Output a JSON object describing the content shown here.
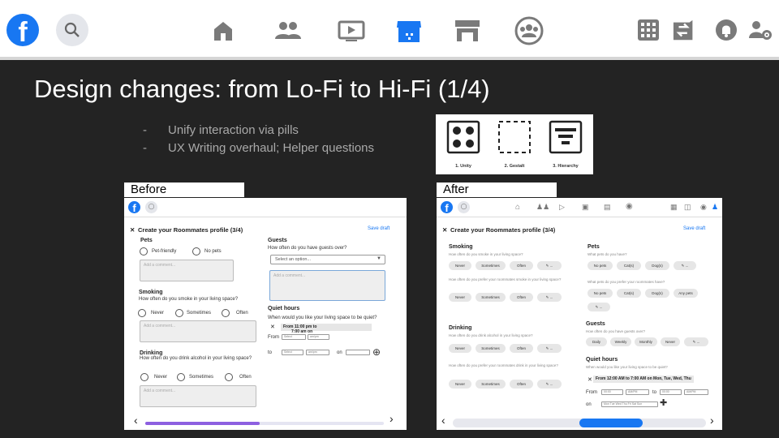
{
  "topbar": {
    "logo": "f",
    "icons": [
      "search-icon",
      "home-icon",
      "friends-icon",
      "watch-icon",
      "marketplace-icon",
      "store-icon",
      "groups-icon",
      "menu-grid-icon",
      "messenger-icon",
      "notifications-icon",
      "account-settings-icon"
    ],
    "active_color": "#1877f2",
    "icon_color": "#7a7a7a"
  },
  "slide": {
    "title": "Design changes: from Lo-Fi to Hi-Fi (1/4)",
    "bullets": [
      "Unify interaction via pills",
      "UX Writing overhaul; Helper questions"
    ],
    "principles": [
      "1. Unity",
      "2. Gestalt",
      "3. Hierarchy"
    ]
  },
  "before": {
    "label": "Before",
    "title": "Create your Roommates profile (3/4)",
    "save": "Save draft",
    "pets": {
      "heading": "Pets",
      "options": [
        "Pet-friendly",
        "No pets"
      ],
      "placeholder": "Add a comment..."
    },
    "smoking": {
      "heading": "Smoking",
      "question": "How often do you smoke in your living space?",
      "options": [
        "Never",
        "Sometimes",
        "Often"
      ],
      "placeholder": "Add a comment..."
    },
    "drinking": {
      "heading": "Drinking",
      "question": "How often do you drink alcohol in your living space?",
      "options": [
        "Never",
        "Sometimes",
        "Often"
      ],
      "placeholder": "Add a comment..."
    },
    "guests": {
      "heading": "Guests",
      "question": "How often do you have guests over?",
      "select": "Select an option...",
      "placeholder": "Add a comment..."
    },
    "quiet": {
      "heading": "Quiet hours",
      "question": "When would you like your living space to be quiet?",
      "chip1": "From 11:00 pm to",
      "chip2": "7:00 am on",
      "from": "From",
      "to": "to",
      "on": "on",
      "sel": "Select",
      "ampm": "am/pm"
    },
    "progress": 0.48
  },
  "after": {
    "label": "After",
    "title": "Create your Roommates profile (3/4)",
    "save": "Save draft",
    "smoking": {
      "heading": "Smoking",
      "q1": "How often do you smoke in your living space?",
      "q2": "How often do you prefer your roommates smoke in your living space?",
      "pills": [
        "Never",
        "Sometimes",
        "Often"
      ]
    },
    "drinking": {
      "heading": "Drinking",
      "q1": "How often do you drink alcohol in your living space?",
      "q2": "How often do you prefer your roommates drink in your living space?",
      "pills": [
        "Never",
        "Sometimes",
        "Often"
      ]
    },
    "pets": {
      "heading": "Pets",
      "q1": "What pets do you have?",
      "q2": "What pets do you prefer your roommates have?",
      "pills1": [
        "No pets",
        "Cat(s)",
        "Dog(s)"
      ],
      "pills2": [
        "No pets",
        "Cat(s)",
        "Dog(s)",
        "Any pets"
      ]
    },
    "guests": {
      "heading": "Guests",
      "question": "How often do you have guests over?",
      "pills": [
        "Daily",
        "Weekly",
        "Monthly",
        "Never"
      ]
    },
    "quiet": {
      "heading": "Quiet hours",
      "question": "When would you like your living space to be quiet?",
      "chip": "From 12:00 AM to 7:00 AM on Mon, Tue, Wed, Thu",
      "from": "From",
      "to": "to",
      "on": "on",
      "days": "Mon Tue Wed Thu Fri Sat Sun",
      "t1": "00:00",
      "t2": "AM/PM"
    },
    "progress": 0.5
  }
}
